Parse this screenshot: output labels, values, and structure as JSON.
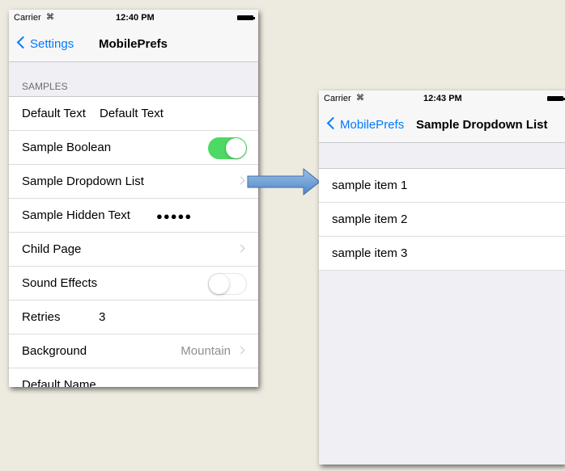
{
  "left_screen": {
    "status_bar": {
      "carrier": "Carrier",
      "wifi_icon": "wifi-icon",
      "time": "12:40 PM"
    },
    "nav": {
      "back_label": "Settings",
      "title": "MobilePrefs"
    },
    "section_header": "SAMPLES",
    "rows": [
      {
        "label": "Default Text",
        "value": "Default Text"
      },
      {
        "label": "Sample Boolean",
        "toggle": true
      },
      {
        "label": "Sample Dropdown List",
        "disclosure": true
      },
      {
        "label": "Sample Hidden Text",
        "value": "●●●●●"
      },
      {
        "label": "Child Page",
        "disclosure": true
      },
      {
        "label": "Sound Effects",
        "toggle": false
      },
      {
        "label": "Retries",
        "value": "3"
      },
      {
        "label": "Background",
        "detail": "Mountain",
        "disclosure": true
      },
      {
        "label": "Default Name"
      }
    ]
  },
  "right_screen": {
    "status_bar": {
      "carrier": "Carrier",
      "wifi_icon": "wifi-icon",
      "time": "12:43 PM"
    },
    "nav": {
      "back_label": "MobilePrefs",
      "title": "Sample Dropdown List"
    },
    "items": [
      {
        "label": "sample item 1"
      },
      {
        "label": "sample item 2"
      },
      {
        "label": "sample item 3"
      }
    ]
  },
  "colors": {
    "accent": "#007aff",
    "toggle_on": "#4cd964",
    "background": "#edeae0",
    "arrow": "#6a9fd4"
  }
}
